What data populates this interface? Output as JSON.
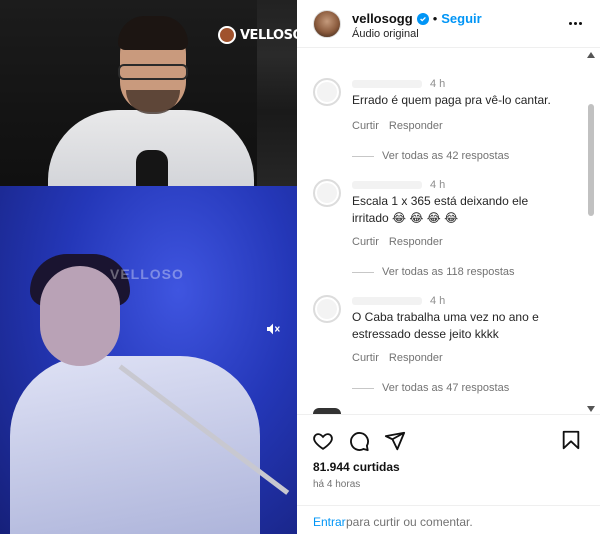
{
  "media": {
    "logo_text": "VELLOSO",
    "watermark_text": "VELLOSO"
  },
  "header": {
    "username": "vellosogg",
    "separator": "•",
    "follow_label": "Seguir",
    "audio_label": "Áudio original"
  },
  "comments": [
    {
      "time": "4 h",
      "text": "Errado é quem paga pra vê-lo cantar.",
      "like_label": "Curtir",
      "reply_label": "Responder",
      "view_replies": "Ver todas as 42 respostas"
    },
    {
      "time": "4 h",
      "text": "Escala 1 x 365 está deixando ele irritado 😂 😂 😂 😂",
      "like_label": "Curtir",
      "reply_label": "Responder",
      "view_replies": "Ver todas as 118 respostas"
    },
    {
      "time": "4 h",
      "text": "O Caba trabalha uma vez no ano e estressado desse jeito kkkk",
      "like_label": "Curtir",
      "reply_label": "Responder",
      "view_replies": "Ver todas as 47 respostas"
    }
  ],
  "stats": {
    "likes": "81.944 curtidas",
    "time_ago": "há 4 horas"
  },
  "compose": {
    "enter_label": "Entrar",
    "rest_label": "para curtir ou comentar."
  },
  "colors": {
    "accent": "#0095f6",
    "stage_blue": "#2437b8"
  }
}
